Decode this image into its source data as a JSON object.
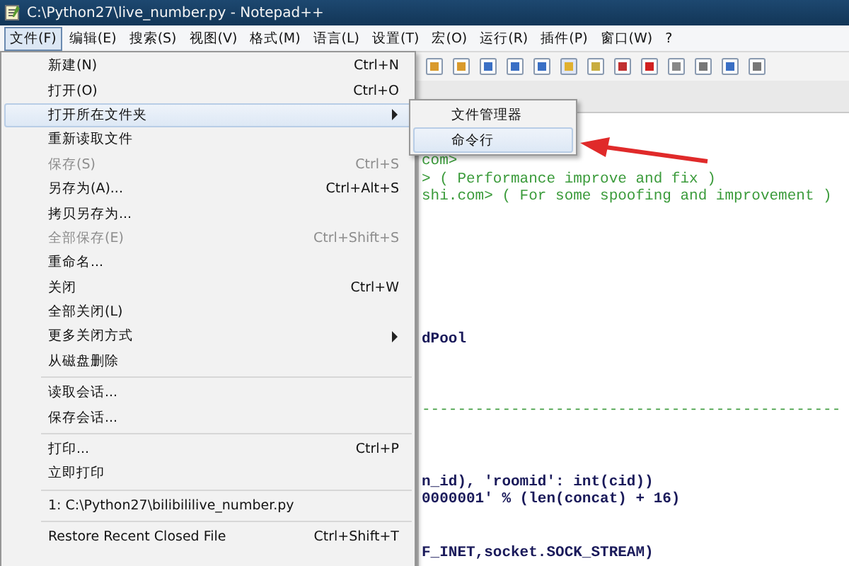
{
  "window": {
    "title": "C:\\Python27\\live_number.py - Notepad++"
  },
  "menu_bar": [
    {
      "label": "文件(F)",
      "selected": true
    },
    {
      "label": "编辑(E)",
      "selected": false
    },
    {
      "label": "搜索(S)",
      "selected": false
    },
    {
      "label": "视图(V)",
      "selected": false
    },
    {
      "label": "格式(M)",
      "selected": false
    },
    {
      "label": "语言(L)",
      "selected": false
    },
    {
      "label": "设置(T)",
      "selected": false
    },
    {
      "label": "宏(O)",
      "selected": false
    },
    {
      "label": "运行(R)",
      "selected": false
    },
    {
      "label": "插件(P)",
      "selected": false
    },
    {
      "label": "窗口(W)",
      "selected": false
    },
    {
      "label": "?",
      "selected": false
    }
  ],
  "file_menu": [
    {
      "kind": "item",
      "label": "新建(N)",
      "shortcut": "Ctrl+N",
      "disabled": false,
      "selected": false,
      "has_submenu": false
    },
    {
      "kind": "item",
      "label": "打开(O)",
      "shortcut": "Ctrl+O",
      "disabled": false,
      "selected": false,
      "has_submenu": false
    },
    {
      "kind": "item",
      "label": "打开所在文件夹",
      "disabled": false,
      "selected": true,
      "has_submenu": true
    },
    {
      "kind": "item",
      "label": "重新读取文件",
      "disabled": false,
      "selected": false,
      "has_submenu": false
    },
    {
      "kind": "item",
      "label": "保存(S)",
      "shortcut": "Ctrl+S",
      "disabled": true,
      "selected": false,
      "has_submenu": false
    },
    {
      "kind": "item",
      "label": "另存为(A)...",
      "shortcut": "Ctrl+Alt+S",
      "disabled": false,
      "selected": false,
      "has_submenu": false
    },
    {
      "kind": "item",
      "label": "拷贝另存为...",
      "disabled": false,
      "selected": false,
      "has_submenu": false
    },
    {
      "kind": "item",
      "label": "全部保存(E)",
      "shortcut": "Ctrl+Shift+S",
      "disabled": true,
      "selected": false,
      "has_submenu": false
    },
    {
      "kind": "item",
      "label": "重命名...",
      "disabled": false,
      "selected": false,
      "has_submenu": false
    },
    {
      "kind": "item",
      "label": "关闭",
      "shortcut": "Ctrl+W",
      "disabled": false,
      "selected": false,
      "has_submenu": false
    },
    {
      "kind": "item",
      "label": "全部关闭(L)",
      "disabled": false,
      "selected": false,
      "has_submenu": false
    },
    {
      "kind": "item",
      "label": "更多关闭方式",
      "disabled": false,
      "selected": false,
      "has_submenu": true
    },
    {
      "kind": "item",
      "label": "从磁盘删除",
      "disabled": false,
      "selected": false,
      "has_submenu": false
    },
    {
      "kind": "separator"
    },
    {
      "kind": "item",
      "label": "读取会话...",
      "disabled": false,
      "selected": false,
      "has_submenu": false
    },
    {
      "kind": "item",
      "label": "保存会话...",
      "disabled": false,
      "selected": false,
      "has_submenu": false
    },
    {
      "kind": "separator"
    },
    {
      "kind": "item",
      "label": "打印...",
      "shortcut": "Ctrl+P",
      "disabled": false,
      "selected": false,
      "has_submenu": false
    },
    {
      "kind": "item",
      "label": "立即打印",
      "disabled": false,
      "selected": false,
      "has_submenu": false
    },
    {
      "kind": "separator"
    },
    {
      "kind": "item",
      "label": "1: C:\\Python27\\bilibililive_number.py",
      "disabled": false,
      "selected": false,
      "has_submenu": false
    },
    {
      "kind": "separator"
    },
    {
      "kind": "item",
      "label": "Restore Recent Closed File",
      "shortcut": "Ctrl+Shift+T",
      "disabled": false,
      "selected": false,
      "has_submenu": false
    }
  ],
  "submenu": [
    {
      "label": "文件管理器",
      "selected": false
    },
    {
      "label": "命令行",
      "selected": true
    }
  ],
  "code_lines": [
    {
      "kind": "comment",
      "text": "com>"
    },
    {
      "kind": "comment",
      "text": "> ( Performance improve and fix )"
    },
    {
      "kind": "comment",
      "text": "shi.com> ( For some spoofing and improvement )"
    },
    {
      "kind": "blank"
    },
    {
      "kind": "blank"
    },
    {
      "kind": "blank"
    },
    {
      "kind": "blank"
    },
    {
      "kind": "blank"
    },
    {
      "kind": "blank"
    },
    {
      "kind": "blank"
    },
    {
      "kind": "code",
      "text": "dPool"
    },
    {
      "kind": "blank"
    },
    {
      "kind": "blank"
    },
    {
      "kind": "blank"
    },
    {
      "kind": "comment",
      "text": "-----------------------------------------------"
    },
    {
      "kind": "blank"
    },
    {
      "kind": "blank"
    },
    {
      "kind": "blank"
    },
    {
      "kind": "code",
      "text": "n_id), 'roomid': int(cid))"
    },
    {
      "kind": "code",
      "text": "0000001' % (len(concat) + 16)"
    },
    {
      "kind": "blank"
    },
    {
      "kind": "blank"
    },
    {
      "kind": "code",
      "text": "F_INET,socket.SOCK_STREAM)"
    }
  ]
}
